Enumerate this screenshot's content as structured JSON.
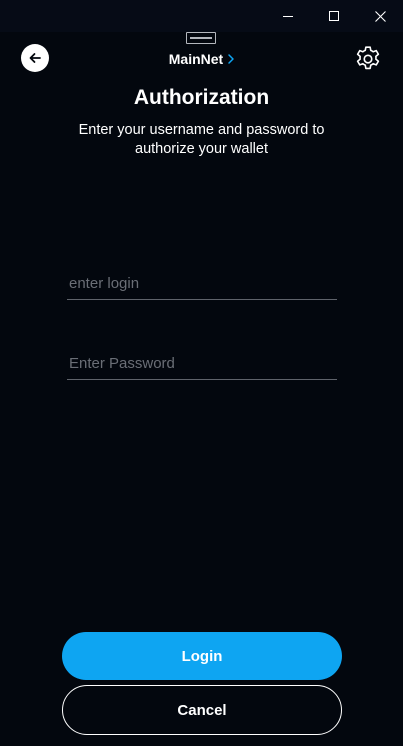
{
  "window": {
    "controls": {
      "minimize_icon": "minimize-icon",
      "maximize_icon": "maximize-icon",
      "close_icon": "close-icon"
    }
  },
  "header": {
    "network": "MainNet",
    "back_icon": "arrow-left-icon",
    "settings_icon": "gear-icon",
    "chevron_icon": "chevron-right-icon",
    "chevron_color": "#0ea5f2"
  },
  "auth": {
    "title": "Authorization",
    "subtitle": "Enter your username and password to authorize your wallet",
    "login_placeholder": "enter login",
    "login_value": "",
    "password_placeholder": "Enter Password",
    "password_value": ""
  },
  "actions": {
    "login_label": "Login",
    "cancel_label": "Cancel"
  },
  "colors": {
    "background": "#03070e",
    "accent": "#0ea5f2",
    "text": "#ffffff",
    "placeholder": "#6a6e76"
  }
}
